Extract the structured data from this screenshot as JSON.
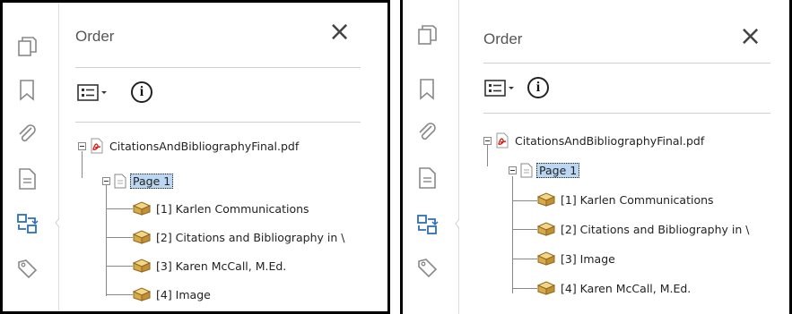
{
  "left": {
    "title": "Order",
    "close": "×",
    "info": "i",
    "file": "CitationsAndBibliographyFinal.pdf",
    "page": "Page 1",
    "items": [
      "[1] Karlen Communications",
      "[2] Citations and Bibliography in \\",
      "[3] Karen McCall, M.Ed.",
      "[4] Image"
    ]
  },
  "right": {
    "title": "Order",
    "close": "×",
    "info": "i",
    "file": "CitationsAndBibliographyFinal.pdf",
    "page": "Page 1",
    "items": [
      "[1] Karlen Communications",
      "[2] Citations and Bibliography in \\",
      "[3] Image",
      "[4] Karen McCall, M.Ed."
    ]
  },
  "toolstrip_icons": [
    "pages-icon",
    "bookmark-icon",
    "attachment-icon",
    "document-icon",
    "order-icon",
    "tags-icon"
  ],
  "colors": {
    "selection": "#bcd7f2",
    "order_icon": "#2e6fb4",
    "pdf_red": "#d4251b"
  }
}
